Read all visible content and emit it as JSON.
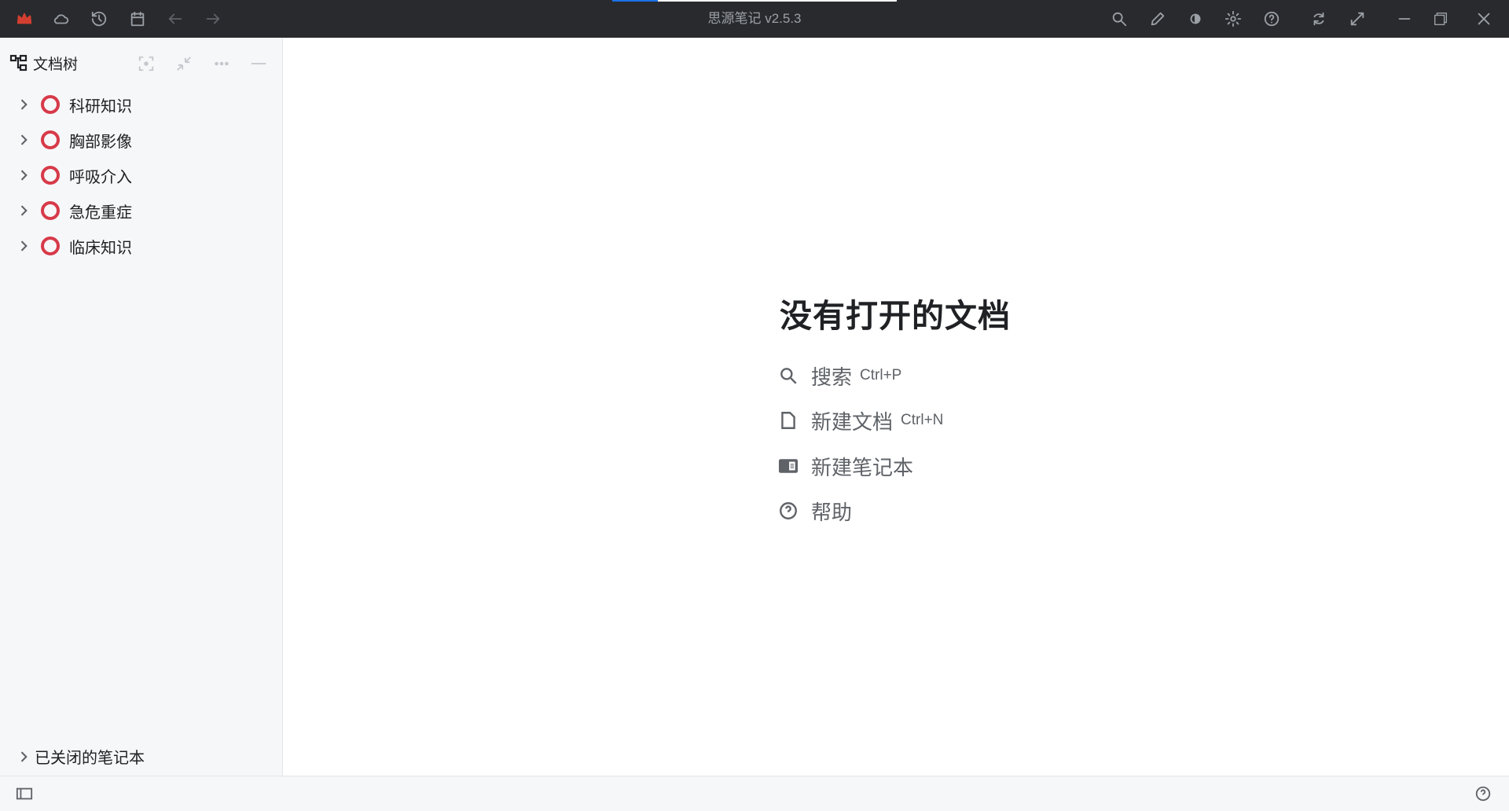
{
  "app": {
    "title": "思源笔记 v2.5.3",
    "accent": "#1a73e8",
    "progress": 0.16
  },
  "sidebar": {
    "title": "文档树",
    "notebooks": [
      {
        "label": "科研知识"
      },
      {
        "label": "胸部影像"
      },
      {
        "label": "呼吸介入"
      },
      {
        "label": "急危重症"
      },
      {
        "label": "临床知识"
      }
    ],
    "closed_label": "已关闭的笔记本"
  },
  "main": {
    "empty_title": "没有打开的文档",
    "actions": [
      {
        "label": "搜索",
        "shortcut": "Ctrl+P"
      },
      {
        "label": "新建文档",
        "shortcut": "Ctrl+N"
      },
      {
        "label": "新建笔记本"
      },
      {
        "label": "帮助"
      }
    ]
  }
}
